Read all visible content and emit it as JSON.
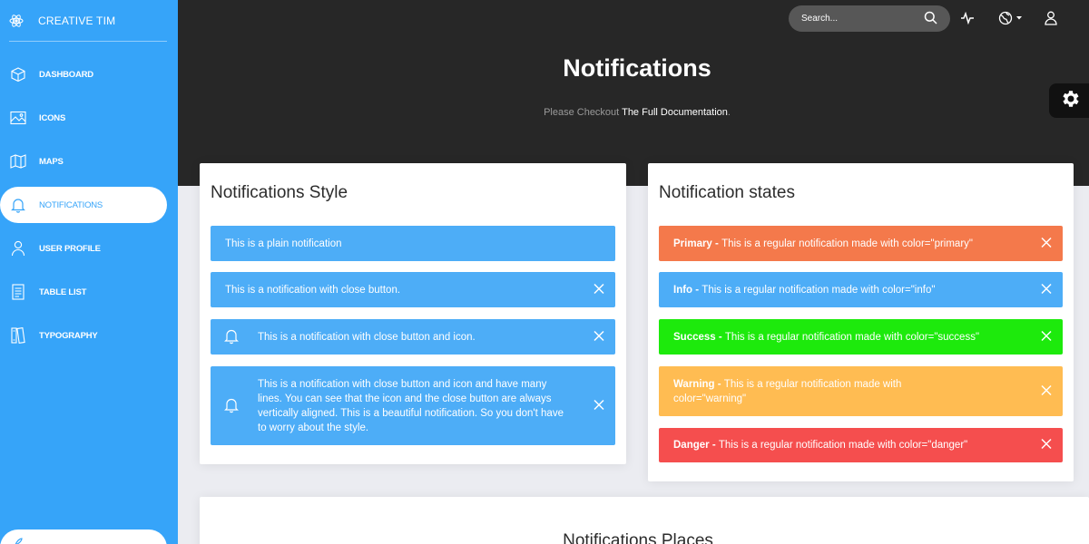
{
  "colors": {
    "sidebar": "#36a4f9",
    "header": "#272727",
    "info": "#4dadf7",
    "primary": "#f4794b",
    "success": "#1dea0c",
    "warning": "#ffbc52",
    "danger": "#f54e4e"
  },
  "brand": {
    "name": "CREATIVE TIM",
    "icon": "react-atom-icon"
  },
  "sidebar": {
    "items": [
      {
        "label": "DASHBOARD",
        "icon": "cube-icon"
      },
      {
        "label": "ICONS",
        "icon": "image-icon"
      },
      {
        "label": "MAPS",
        "icon": "map-icon"
      },
      {
        "label": "NOTIFICATIONS",
        "icon": "bell-icon",
        "active": true
      },
      {
        "label": "USER PROFILE",
        "icon": "user-icon"
      },
      {
        "label": "TABLE LIST",
        "icon": "list-icon"
      },
      {
        "label": "TYPOGRAPHY",
        "icon": "typography-icon"
      }
    ]
  },
  "topbar": {
    "search_placeholder": "Search...",
    "icons": [
      "activity-icon",
      "globe-icon",
      "user-icon"
    ]
  },
  "header": {
    "title": "Notifications",
    "subtitle_prefix": "Please Checkout",
    "subtitle_link": "The Full Documentation",
    "subtitle_suffix": "."
  },
  "styles_card": {
    "title": "Notifications Style",
    "items": [
      {
        "text": "This is a plain notification"
      },
      {
        "text": "This is a notification with close button."
      },
      {
        "text": "This is a notification with close button and icon."
      },
      {
        "text": "This is a notification with close button and icon and have many lines. You can see that the icon and the close button are always vertically aligned. This is a beautiful notification. So you don't have to worry about the style."
      }
    ]
  },
  "states_card": {
    "title": "Notification states",
    "items": [
      {
        "label": "Primary - ",
        "text": "This is a regular notification made with color=\"primary\""
      },
      {
        "label": "Info - ",
        "text": "This is a regular notification made with color=\"info\""
      },
      {
        "label": "Success - ",
        "text": "This is a regular notification made with color=\"success\""
      },
      {
        "label": "Warning - ",
        "text": "This is a regular notification made with color=\"warning\""
      },
      {
        "label": "Danger - ",
        "text": "This is a regular notification made with color=\"danger\""
      }
    ]
  },
  "places_card": {
    "title": "Notifications Places"
  }
}
